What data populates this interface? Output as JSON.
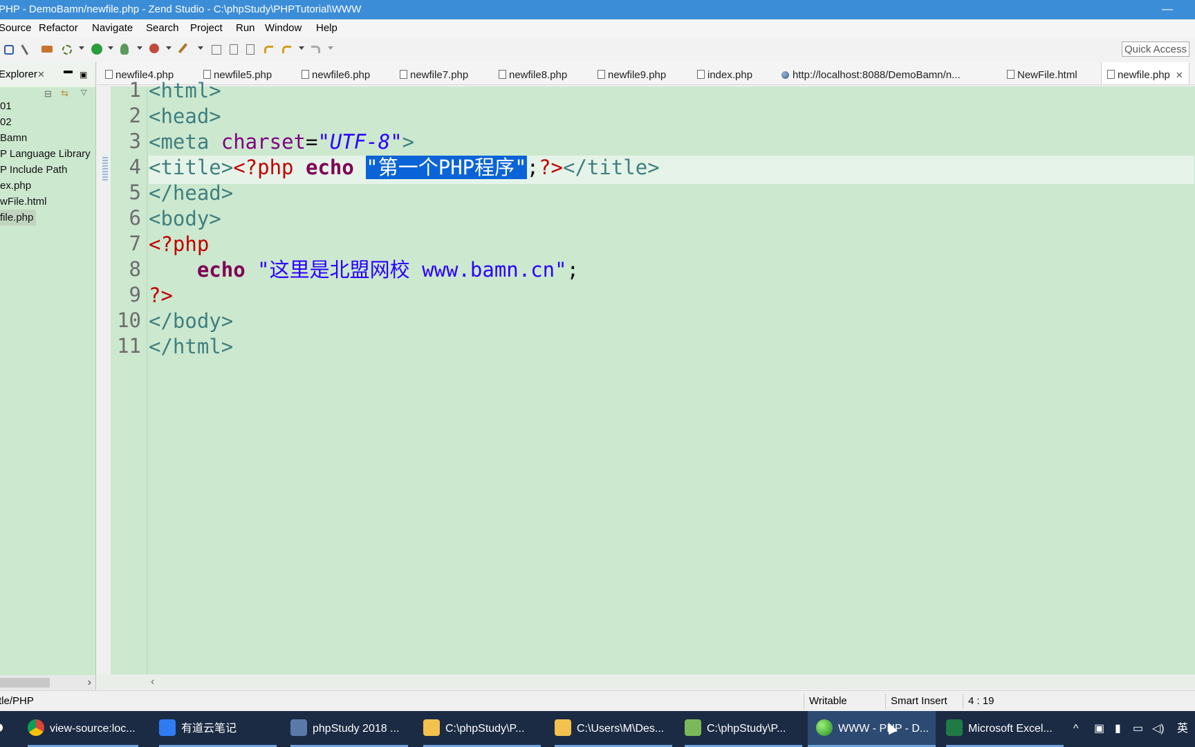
{
  "window": {
    "title": "PHP - DemoBamn/newfile.php - Zend Studio - C:\\phpStudy\\PHPTutorial\\WWW"
  },
  "menu": [
    "Source",
    "Refactor",
    "Navigate",
    "Search",
    "Project",
    "Run",
    "Window",
    "Help"
  ],
  "toolbar": {
    "quick_access": "Quick Access"
  },
  "explorer": {
    "title": "Explorer",
    "items": [
      "01",
      "02",
      "Bamn",
      "P Language Library",
      "P Include Path",
      "ex.php",
      "wFile.html",
      "file.php"
    ]
  },
  "tabs": [
    {
      "label": "newfile4.php",
      "icon": "php-file-icon"
    },
    {
      "label": "newfile5.php",
      "icon": "php-file-icon"
    },
    {
      "label": "newfile6.php",
      "icon": "php-file-icon"
    },
    {
      "label": "newfile7.php",
      "icon": "php-file-icon"
    },
    {
      "label": "newfile8.php",
      "icon": "php-file-icon"
    },
    {
      "label": "newfile9.php",
      "icon": "php-file-icon"
    },
    {
      "label": "index.php",
      "icon": "php-file-icon"
    },
    {
      "label": "http://localhost:8088/DemoBamn/n...",
      "icon": "globe-icon"
    },
    {
      "label": "NewFile.html",
      "icon": "html-file-icon"
    },
    {
      "label": "newfile.php",
      "icon": "php-file-icon",
      "active": true
    }
  ],
  "editor": {
    "line_numbers": [
      "1",
      "2",
      "3",
      "4",
      "5",
      "6",
      "7",
      "8",
      "9",
      "10",
      "11"
    ],
    "lines": {
      "l1": "<html>",
      "l2": "<head>",
      "l3_tag_open": "<meta ",
      "l3_attr": "charset",
      "l3_eq": "=",
      "l3_val": "\"UTF-8\"",
      "l3_tag_close": ">",
      "l4_tag": "<title>",
      "l4_php_open": "<?php ",
      "l4_kw": "echo",
      "l4_space": " ",
      "l4_str": "\"第一个PHP程序\"",
      "l4_semi": ";",
      "l4_php_close": "?>",
      "l4_tag_close": "</title>",
      "l5": "</head>",
      "l6": "<body>",
      "l7": "<?php",
      "l8_indent": "    ",
      "l8_kw": "echo",
      "l8_str": " \"这里是北盟网校 www.bamn.cn\"",
      "l8_semi": ";",
      "l9": "?>",
      "l10": "</body>",
      "l11": "</html>"
    }
  },
  "status": {
    "path": "tle/PHP",
    "writable": "Writable",
    "insert_mode": "Smart Insert",
    "position": "4 : 19"
  },
  "taskbar": {
    "items": [
      {
        "label": "view-source:loc...",
        "icon": "chrome-icon"
      },
      {
        "label": "有道云笔记",
        "icon": "youdao-note-icon"
      },
      {
        "label": "phpStudy 2018 ...",
        "icon": "phpstudy-icon"
      },
      {
        "label": "C:\\phpStudy\\P...",
        "icon": "folder-icon"
      },
      {
        "label": "C:\\Users\\M\\Des...",
        "icon": "folder-icon"
      },
      {
        "label": "C:\\phpStudy\\P...",
        "icon": "notepad-icon"
      },
      {
        "label": "WWW - PHP - D...",
        "icon": "zend-studio-icon",
        "active": true
      },
      {
        "label": "Microsoft Excel...",
        "icon": "excel-icon"
      }
    ],
    "tray": {
      "ime": "英"
    }
  },
  "colors": {
    "titlebar": "#3c8dd8",
    "editor_bg": "#cce8cf",
    "selection": "#0a64d8",
    "taskbar": "#1b2b44"
  }
}
